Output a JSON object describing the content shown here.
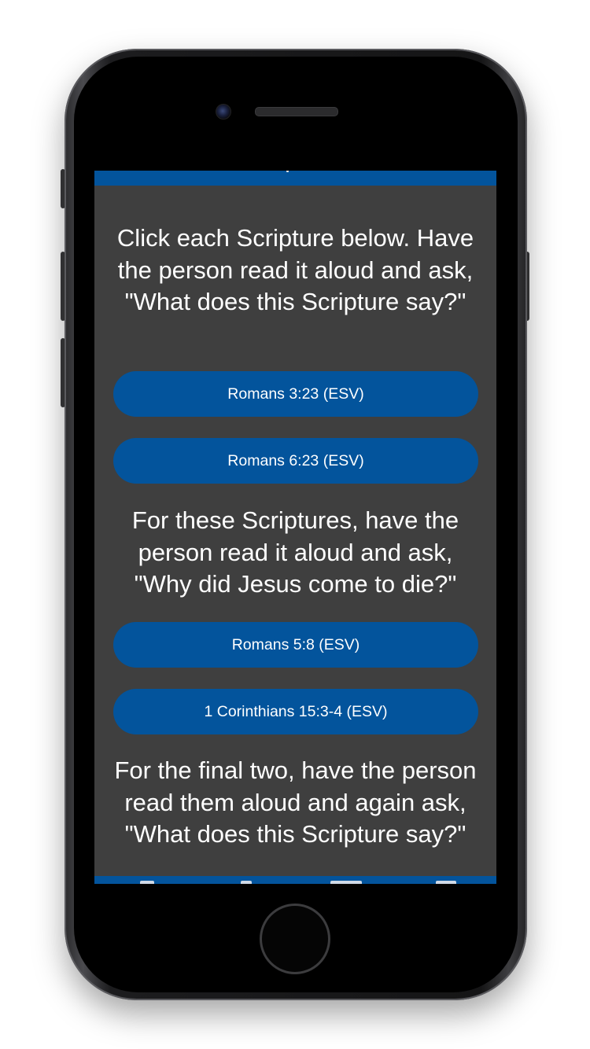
{
  "instructions": {
    "block1": "Click each Scripture below. Have the person read it aloud and ask, \"What does this Scripture say?\"",
    "block2": "For these Scriptures, have the person read it aloud and ask, \"Why did Jesus come to die?\"",
    "block3": "For the final two, have the person read them aloud and again ask, \"What does this Scripture say?\""
  },
  "scripture_buttons": [
    {
      "label": "Romans 3:23 (ESV)"
    },
    {
      "label": "Romans 6:23 (ESV)"
    },
    {
      "label": "Romans 5:8 (ESV)"
    },
    {
      "label": "1 Corinthians 15:3-4 (ESV)"
    }
  ],
  "colors": {
    "accent": "#03549c",
    "background": "#3f3f3f",
    "text": "#ffffff"
  }
}
